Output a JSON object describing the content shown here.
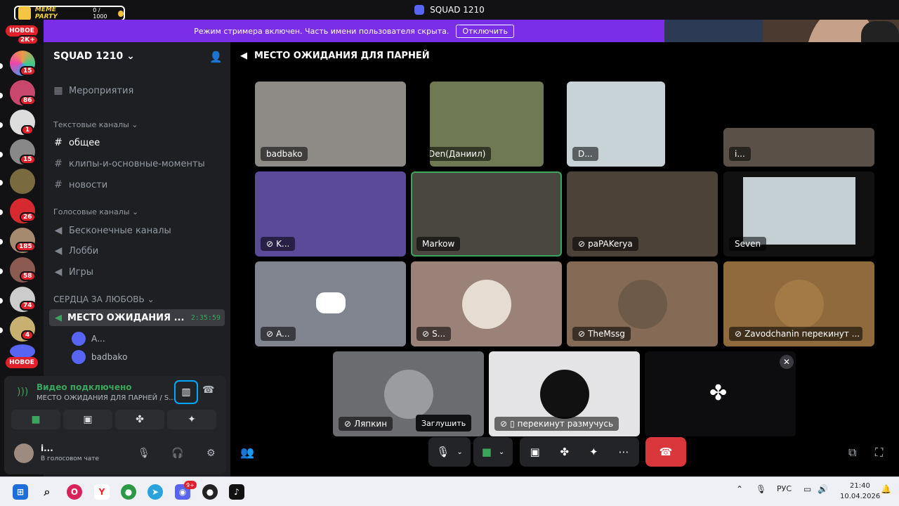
{
  "window": {
    "title": "SQUAD 1210"
  },
  "overlay": {
    "meme_title": "MEME PARTY",
    "meme_counter": "0 / 1000"
  },
  "banner": {
    "text": "Режим стримера включен. Часть имени пользователя скрыта.",
    "button": "Отключить"
  },
  "rail": {
    "badges": [
      "2K+",
      "15",
      "86",
      "1",
      "15",
      "26",
      "185",
      "58",
      "74",
      "4"
    ],
    "new_label": "НОВОЕ"
  },
  "sidebar": {
    "server_name": "SQUAD 1210",
    "events": "Мероприятия",
    "text_category": "Текстовые каналы",
    "text_channels": [
      "общее",
      "клипы-и-основные-моменты",
      "новости"
    ],
    "voice_category": "Голосовые каналы",
    "voice_channels": [
      "Бесконечные каналы",
      "Лобби",
      "Игры"
    ],
    "hearts_category": "СЕРДЦА ЗА ЛЮБОВЬ",
    "active_channel": "МЕСТО ОЖИДАНИЯ ...",
    "active_timer": "2:35:59",
    "users": [
      "А...",
      "badbako"
    ]
  },
  "voice_panel": {
    "status": "Видео подключено",
    "channel": "МЕСТО ОЖИДАНИЯ ДЛЯ ПАРНЕЙ / S...",
    "user_name": "i...",
    "user_status": "В голосовом чате"
  },
  "main": {
    "channel_title": "МЕСТО ОЖИДАНИЯ ДЛЯ ПАРНЕЙ",
    "tiles": [
      {
        "name": "badbako",
        "muted": false
      },
      {
        "name": "Den(Даниил)",
        "muted": false
      },
      {
        "name": "D...",
        "muted": false
      },
      {
        "name": "i...",
        "muted": false
      },
      {
        "name": "K...",
        "muted": true
      },
      {
        "name": "Markow",
        "muted": false
      },
      {
        "name": "paPAKerya",
        "muted": true
      },
      {
        "name": "Seven",
        "muted": false
      },
      {
        "name": "A...",
        "muted": true
      },
      {
        "name": "S...",
        "muted": true
      },
      {
        "name": "TheMssg",
        "muted": true
      },
      {
        "name": "Zavodchanin перекинут ...",
        "muted": true
      },
      {
        "name": "Ляпкин",
        "muted": true
      },
      {
        "name": "перекинут размучусь",
        "muted": true
      }
    ],
    "tooltip": "Заглушить"
  },
  "taskbar": {
    "lang": "РУС",
    "time": "21:40",
    "date": "10.04.2026",
    "discord_badge": "9+"
  },
  "colors": {
    "accent": "#5865f2",
    "banner": "#7a2ee8",
    "green": "#3ba55d",
    "red": "#da373c"
  }
}
